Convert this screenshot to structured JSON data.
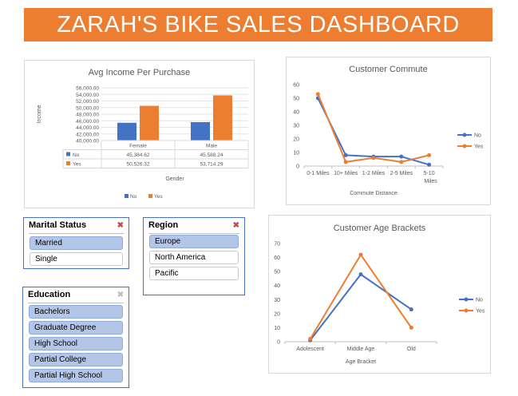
{
  "dashboard": {
    "title": "ZARAH'S BIKE SALES DASHBOARD",
    "colors": {
      "banner": "#ed7d31",
      "series_no": "#4472c4",
      "series_yes": "#ed7d31",
      "slicer_selected": "#b4c6e7"
    }
  },
  "income_chart": {
    "title": "Avg Income Per Purchase",
    "ylabel": "Income",
    "xlabel": "Gender",
    "yticks": [
      "56,000.00",
      "54,000.00",
      "52,000.00",
      "50,000.00",
      "48,000.00",
      "46,000.00",
      "44,000.00",
      "42,000.00",
      "40,000.00"
    ],
    "table": {
      "rows": [
        {
          "label": "No",
          "cells": [
            "45,384.62",
            "45,588.24"
          ]
        },
        {
          "label": "Yes",
          "cells": [
            "50,526.32",
            "53,714.29"
          ]
        }
      ]
    },
    "legend": [
      "No",
      "Yes"
    ]
  },
  "commute_chart": {
    "title": "Customer Commute",
    "xlabel": "Commute Distance",
    "yticks": [
      "0",
      "10",
      "20",
      "30",
      "40",
      "50",
      "60"
    ],
    "categories": [
      "0-1 Miles",
      "10+ Miles",
      "1-2 Miles",
      "2-5 Miles",
      "5-10 Miles"
    ],
    "legend": [
      "No",
      "Yes"
    ]
  },
  "age_chart": {
    "title": "Customer Age Brackets",
    "xlabel": "Age Bracket",
    "yticks": [
      "0",
      "10",
      "20",
      "30",
      "40",
      "50",
      "60",
      "70"
    ],
    "categories": [
      "Adolescent",
      "Middle Age",
      "Old"
    ],
    "legend": [
      "No",
      "Yes"
    ]
  },
  "chart_data": [
    {
      "type": "bar",
      "title": "Avg Income Per Purchase",
      "xlabel": "Gender",
      "ylabel": "Income",
      "categories": [
        "Female",
        "Male"
      ],
      "series": [
        {
          "name": "No",
          "values": [
            45384.62,
            45588.24
          ]
        },
        {
          "name": "Yes",
          "values": [
            50526.32,
            53714.29
          ]
        }
      ],
      "ylim": [
        40000,
        56000
      ],
      "grid": true,
      "legend": "bottom"
    },
    {
      "type": "line",
      "title": "Customer Commute",
      "xlabel": "Commute Distance",
      "ylabel": "",
      "categories": [
        "0-1 Miles",
        "10+ Miles",
        "1-2 Miles",
        "2-5 Miles",
        "5-10 Miles"
      ],
      "series": [
        {
          "name": "No",
          "values": [
            50,
            8,
            7,
            7,
            1
          ]
        },
        {
          "name": "Yes",
          "values": [
            53,
            3,
            6,
            3,
            8
          ]
        }
      ],
      "ylim": [
        0,
        60
      ],
      "grid": false,
      "legend": "right"
    },
    {
      "type": "line",
      "title": "Customer Age Brackets",
      "xlabel": "Age Bracket",
      "ylabel": "",
      "categories": [
        "Adolescent",
        "Middle Age",
        "Old"
      ],
      "series": [
        {
          "name": "No",
          "values": [
            1,
            48,
            23
          ]
        },
        {
          "name": "Yes",
          "values": [
            2,
            62,
            10
          ]
        }
      ],
      "ylim": [
        0,
        70
      ],
      "grid": false,
      "legend": "right"
    }
  ],
  "slicers": {
    "marital": {
      "title": "Marital Status",
      "icon": "clear-filter-icon",
      "items": [
        {
          "label": "Married",
          "selected": true
        },
        {
          "label": "Single",
          "selected": false
        }
      ]
    },
    "region": {
      "title": "Region",
      "icon": "clear-filter-icon",
      "items": [
        {
          "label": "Europe",
          "selected": true
        },
        {
          "label": "North America",
          "selected": false
        },
        {
          "label": "Pacific",
          "selected": false
        }
      ]
    },
    "education": {
      "title": "Education",
      "icon": "clear-filter-icon",
      "items": [
        {
          "label": "Bachelors",
          "selected": true
        },
        {
          "label": "Graduate Degree",
          "selected": true
        },
        {
          "label": "High School",
          "selected": true
        },
        {
          "label": "Partial College",
          "selected": true
        },
        {
          "label": "Partial High School",
          "selected": true
        }
      ]
    }
  }
}
